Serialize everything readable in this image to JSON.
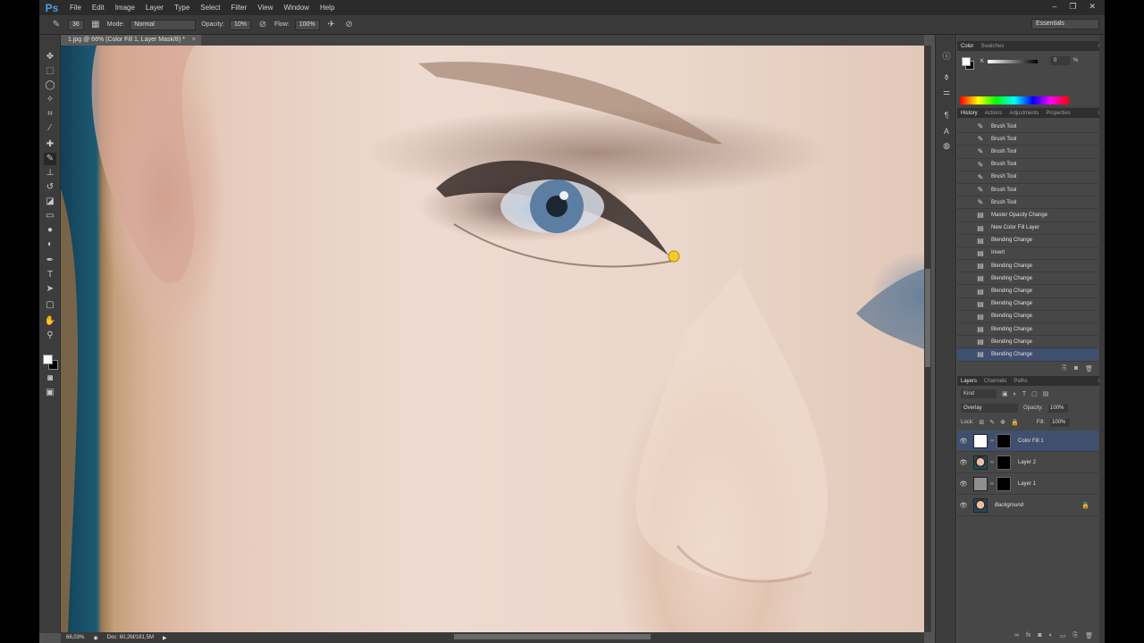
{
  "app": {
    "logo": "Ps"
  },
  "menu": [
    "File",
    "Edit",
    "Image",
    "Layer",
    "Type",
    "Select",
    "Filter",
    "View",
    "Window",
    "Help"
  ],
  "window_controls": [
    "–",
    "❐",
    "✕"
  ],
  "options": {
    "brush_size": "36",
    "mode_label": "Mode:",
    "mode_value": "Normal",
    "opacity_label": "Opacity:",
    "opacity_value": "10%",
    "flow_label": "Flow:",
    "flow_value": "100%",
    "workspace": "Essentials"
  },
  "document": {
    "tab_title": "1.jpg @ 66% (Color Fill 1, Layer Mask/8) *",
    "tab_close": "×"
  },
  "status": {
    "zoom": "66,03%",
    "doc": "Doc: 60,2M/181,5M",
    "arrow": "▶"
  },
  "color_panel": {
    "tabs": [
      "Color",
      "Swatches"
    ],
    "k_label": "K",
    "k_value": "0",
    "k_unit": "%"
  },
  "history_panel": {
    "tabs": [
      "History",
      "Actions",
      "Adjustments",
      "Properties"
    ],
    "items": [
      {
        "label": "Brush Tool",
        "icon": "brush-icon"
      },
      {
        "label": "Brush Tool",
        "icon": "brush-icon"
      },
      {
        "label": "Brush Tool",
        "icon": "brush-icon"
      },
      {
        "label": "Brush Tool",
        "icon": "brush-icon"
      },
      {
        "label": "Brush Tool",
        "icon": "brush-icon"
      },
      {
        "label": "Brush Tool",
        "icon": "brush-icon"
      },
      {
        "label": "Brush Tool",
        "icon": "brush-icon"
      },
      {
        "label": "Master Opacity Change",
        "icon": "history-state-icon"
      },
      {
        "label": "New Color Fill Layer",
        "icon": "history-state-icon"
      },
      {
        "label": "Blending Change",
        "icon": "history-state-icon"
      },
      {
        "label": "Invert",
        "icon": "history-state-icon"
      },
      {
        "label": "Blending Change",
        "icon": "history-state-icon"
      },
      {
        "label": "Blending Change",
        "icon": "history-state-icon"
      },
      {
        "label": "Blending Change",
        "icon": "history-state-icon"
      },
      {
        "label": "Blending Change",
        "icon": "history-state-icon"
      },
      {
        "label": "Blending Change",
        "icon": "history-state-icon"
      },
      {
        "label": "Blending Change",
        "icon": "history-state-icon"
      },
      {
        "label": "Blending Change",
        "icon": "history-state-icon"
      },
      {
        "label": "Blending Change",
        "icon": "history-state-icon"
      }
    ],
    "selected_index": 18
  },
  "layers_panel": {
    "tabs": [
      "Layers",
      "Channels",
      "Paths"
    ],
    "kind": "Kind",
    "blend_mode": "Overlay",
    "opacity_label": "Opacity:",
    "opacity_value": "100%",
    "lock_label": "Lock:",
    "fill_label": "Fill:",
    "fill_value": "100%",
    "layers": [
      {
        "name": "Color Fill 1",
        "thumb": "white-fill",
        "has_mask": true,
        "selected": true,
        "italic": false,
        "locked": false
      },
      {
        "name": "Layer 2",
        "thumb": "face",
        "has_mask": true,
        "selected": false,
        "italic": false,
        "locked": false
      },
      {
        "name": "Layer 1",
        "thumb": "gray",
        "has_mask": true,
        "selected": false,
        "italic": false,
        "locked": false
      },
      {
        "name": "Background",
        "thumb": "face",
        "has_mask": false,
        "selected": false,
        "italic": true,
        "locked": true
      }
    ]
  },
  "colors": {
    "selection": "#3f4f6e",
    "panel_bg": "#474747",
    "app_bg": "#535353"
  }
}
